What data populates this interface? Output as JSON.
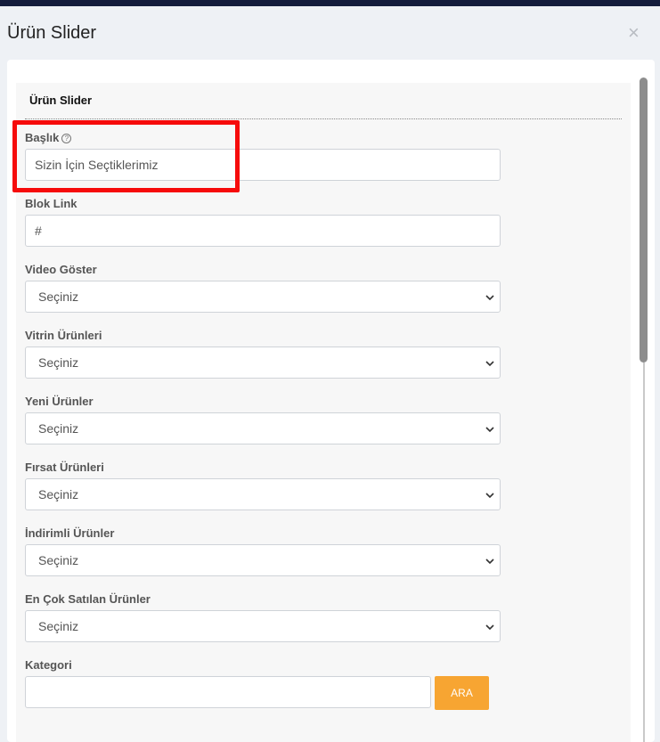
{
  "modal": {
    "title": "Ürün Slider"
  },
  "section": {
    "title": "Ürün Slider"
  },
  "fields": {
    "baslik": {
      "label": "Başlık",
      "value": "Sizin İçin Seçtiklerimiz"
    },
    "blok_link": {
      "label": "Blok Link",
      "value": "#"
    },
    "video_goster": {
      "label": "Video Göster",
      "value": "Seçiniz"
    },
    "vitrin_urunleri": {
      "label": "Vitrin Ürünleri",
      "value": "Seçiniz"
    },
    "yeni_urunler": {
      "label": "Yeni Ürünler",
      "value": "Seçiniz"
    },
    "firsat_urunleri": {
      "label": "Fırsat Ürünleri",
      "value": "Seçiniz"
    },
    "indirimli_urunler": {
      "label": "İndirimli Ürünler",
      "value": "Seçiniz"
    },
    "en_cok_satilan": {
      "label": "En Çok Satılan Ürünler",
      "value": "Seçiniz"
    },
    "kategori": {
      "label": "Kategori",
      "value": "",
      "button": "ARA"
    }
  },
  "icons": {
    "close": "close-icon",
    "help": "question-circle-icon",
    "select": "chevron-down-icon"
  },
  "colors": {
    "accent": "#f7a532",
    "highlight": "#f60b0b",
    "topbar": "#141c3c"
  }
}
